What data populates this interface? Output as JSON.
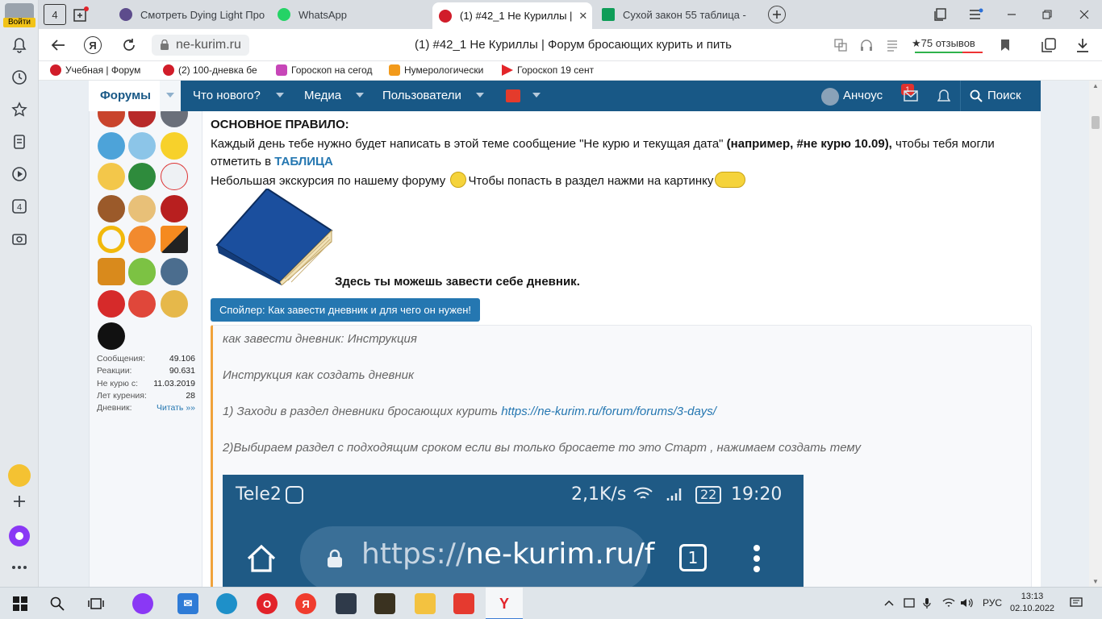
{
  "browser": {
    "profile_label": "Войти",
    "tab_counter": "4",
    "tabs": [
      {
        "title": "Смотреть Dying Light Про",
        "color": "#5d4c8c"
      },
      {
        "title": "WhatsApp",
        "color": "#25d366"
      },
      {
        "title": "(1) #42_1 Не Куриллы |",
        "color": "#d11d2a"
      },
      {
        "title": "Сухой закон 55 таблица -",
        "color": "#0f9d58"
      }
    ],
    "close_symbol": "✕",
    "domain": "ne-kurim.ru",
    "page_title": "(1) #42_1 Не Куриллы | Форум бросающих курить и пить",
    "reviews": "★75 отзывов",
    "bookmarks": [
      "Учебная | Форум",
      "(2) 100-дневка бе",
      "Гороскоп на сегод",
      "Нумерологически",
      "Гороскоп 19 сент"
    ],
    "sidebar_counter": "4"
  },
  "forum_nav": {
    "items": [
      "Форумы",
      "Что нового?",
      "Медиа",
      "Пользователи"
    ],
    "user_name": "Анчоус",
    "unread_count": "1",
    "search_label": "Поиск"
  },
  "user_stats": [
    {
      "label": "Сообщения:",
      "value": "49.106"
    },
    {
      "label": "Реакции:",
      "value": "90.631"
    },
    {
      "label": "Не курю с:",
      "value": "11.03.2019"
    },
    {
      "label": "Лет курения:",
      "value": "28"
    },
    {
      "label": "Дневник:",
      "value": "Читать »»"
    }
  ],
  "post": {
    "rule_title": "ОСНОВНОЕ ПРАВИЛО:",
    "rule_text_1": "Каждый день тебе нужно будет написать в этой теме сообщение \"Не курю и текущая дата\" ",
    "rule_text_bold": "(например, #не курю 10.09),",
    "rule_text_2": " чтобы тебя могли отметить в ",
    "rule_text_link": "ТАБЛИЦА",
    "tour_text_1": "Небольшая экскурсия по нашему форуму ",
    "tour_text_2": "Чтобы попасть в раздел нажми на картинку",
    "book_caption": "Здесь ты можешь завести себе дневник.",
    "spoiler_button": "Спойлер: Как завести дневник и для чего он нужен!",
    "spoiler_lines": [
      "как завести дневник: Инструкция",
      "Инструкция как создать дневник",
      "1) Заходи в раздел дневники бросающих курить ",
      "2)Выбираем раздел с подходящим сроком если вы только бросаете то это Старт , нажимаем создать тему"
    ],
    "spoiler_link": "https://ne-kurim.ru/forum/forums/3-days/"
  },
  "phone_screenshot": {
    "carrier": "Tele2",
    "speed": "2,1K/s",
    "battery": "22",
    "time": "19:20",
    "url_scheme": "https://",
    "url_host": "ne-kurim.ru/f",
    "tab_count": "1"
  },
  "taskbar": {
    "language": "РУС",
    "time": "13:13",
    "date": "02.10.2022"
  }
}
